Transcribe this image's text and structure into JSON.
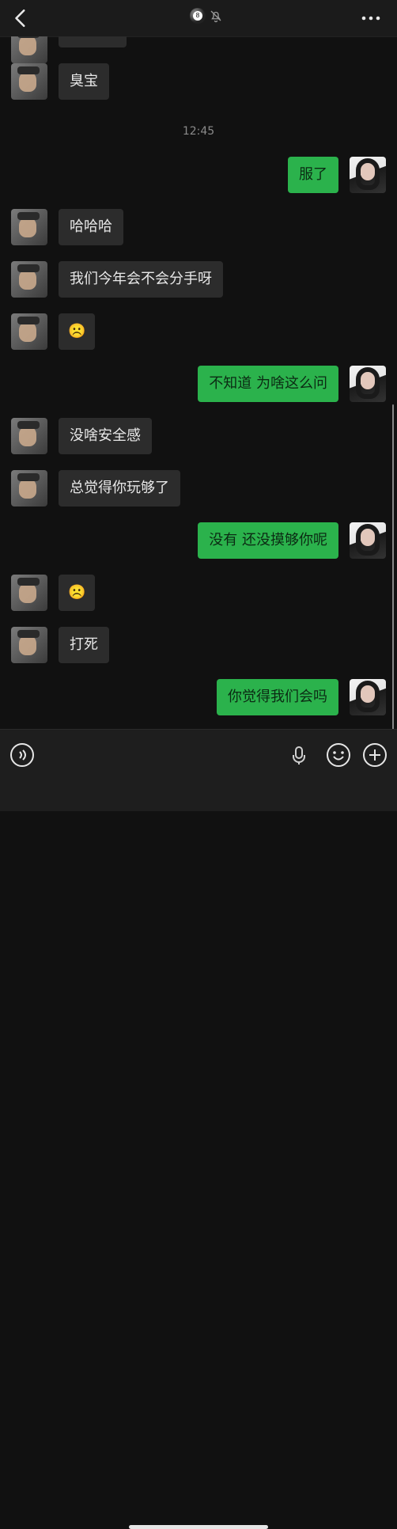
{
  "header": {
    "icons": [
      "back-arrow-icon",
      "8-ball-avatar-icon",
      "mute-bell-icon",
      "more-dots-icon"
    ],
    "ball_char": "8"
  },
  "messages": [
    {
      "side": "left",
      "text": "臭宝"
    },
    {
      "type": "time",
      "text": "12:45"
    },
    {
      "side": "right",
      "text": "服了"
    },
    {
      "side": "left",
      "text": "哈哈哈"
    },
    {
      "side": "left",
      "text": "我们今年会不会分手呀"
    },
    {
      "side": "left",
      "text": "☹️"
    },
    {
      "side": "right",
      "text": "不知道 为啥这么问"
    },
    {
      "side": "left",
      "text": "没啥安全感"
    },
    {
      "side": "left",
      "text": "总觉得你玩够了"
    },
    {
      "side": "right",
      "text": "没有 还没摸够你呢"
    },
    {
      "side": "left",
      "text": "☹️"
    },
    {
      "side": "left",
      "text": "打死"
    },
    {
      "side": "right",
      "text": "你觉得我们会吗"
    }
  ],
  "input_bar": {
    "icons": [
      "voice-mode-icon",
      "microphone-icon",
      "emoji-icon",
      "plus-icon"
    ]
  }
}
